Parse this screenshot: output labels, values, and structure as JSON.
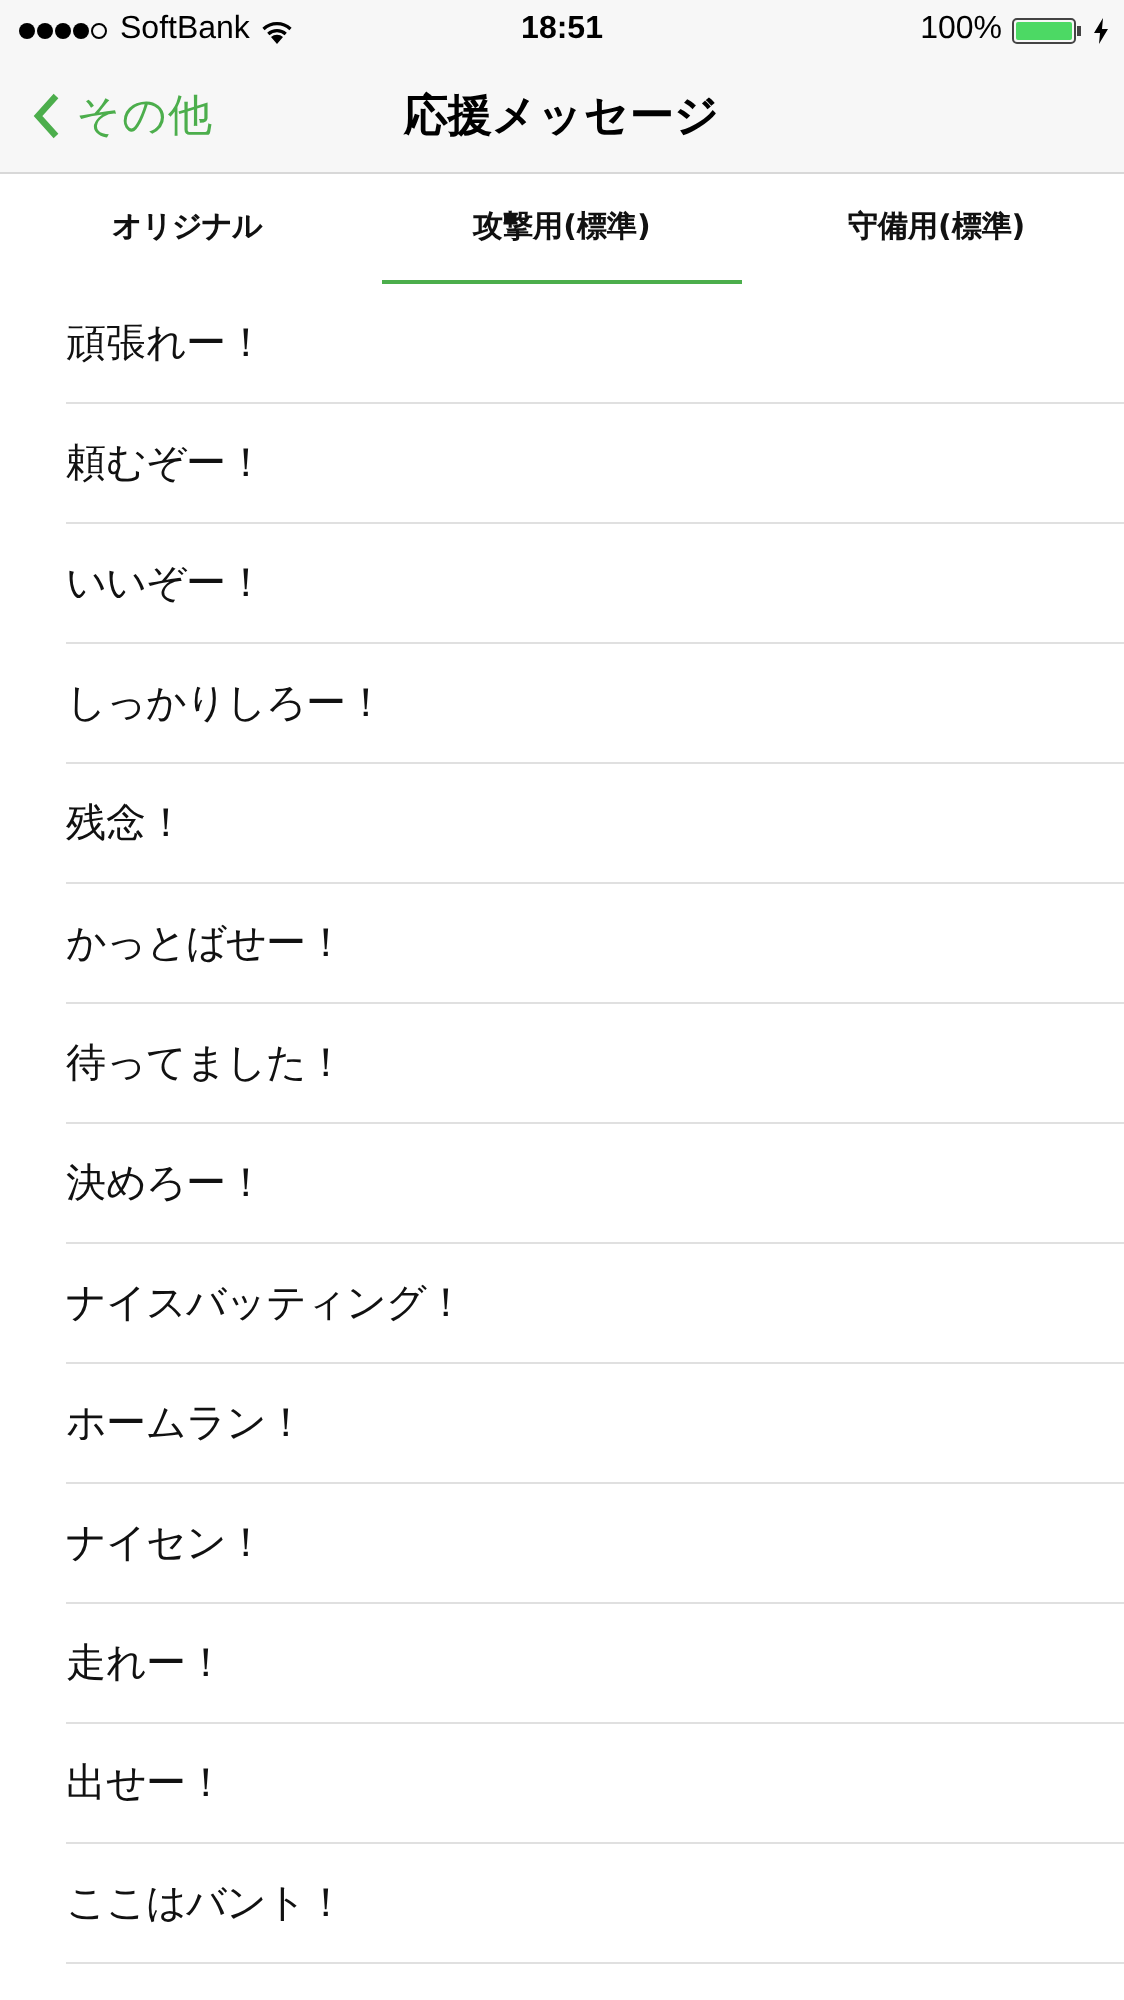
{
  "status_bar": {
    "carrier": "SoftBank",
    "time": "18:51",
    "battery": "100%"
  },
  "nav": {
    "back": "その他",
    "title": "応援メッセージ"
  },
  "tabs": [
    {
      "label": "オリジナル",
      "selected": false
    },
    {
      "label": "攻撃用(標準)",
      "selected": true
    },
    {
      "label": "守備用(標準)",
      "selected": false
    }
  ],
  "messages": [
    "頑張れー！",
    "頼むぞー！",
    "いいぞー！",
    "しっかりしろー！",
    "残念！",
    "かっとばせー！",
    "待ってました！",
    "決めろー！",
    "ナイスバッティング！",
    "ホームラン！",
    "ナイセン！",
    "走れー！",
    "出せー！",
    "ここはバント！"
  ]
}
